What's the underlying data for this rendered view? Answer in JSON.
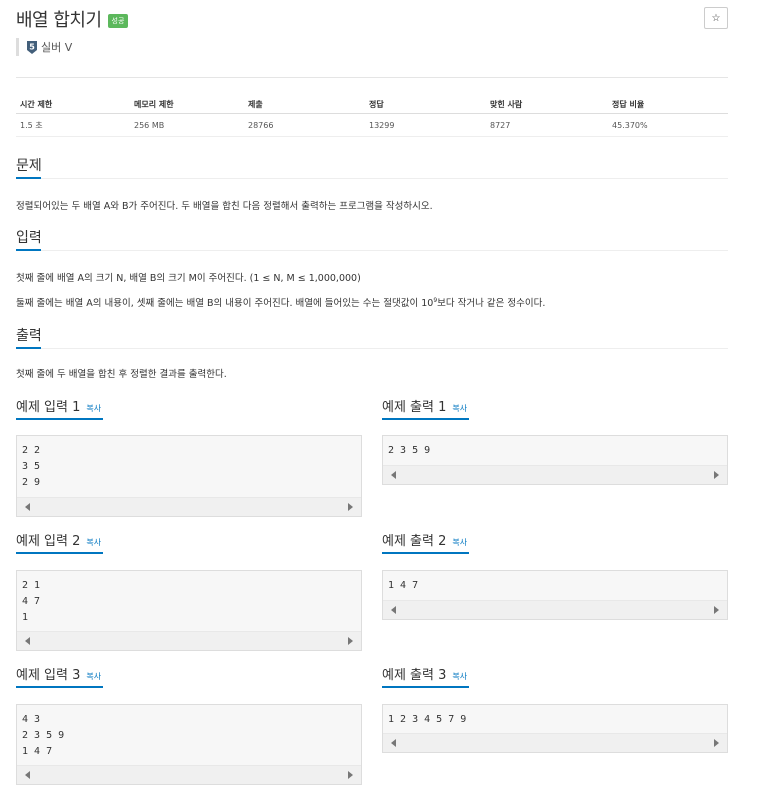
{
  "header": {
    "title": "배열 합치기",
    "status_badge": "성공",
    "star_label": "☆",
    "tier_label": "실버 V",
    "tier_number": "5"
  },
  "stats": {
    "headers": [
      "시간 제한",
      "메모리 제한",
      "제출",
      "정답",
      "맞힌 사람",
      "정답 비율"
    ],
    "values": [
      "1.5 초",
      "256 MB",
      "28766",
      "13299",
      "8727",
      "45.370%"
    ]
  },
  "problem": {
    "title": "문제",
    "text": "정렬되어있는 두 배열 A와 B가 주어진다. 두 배열을 합친 다음 정렬해서 출력하는 프로그램을 작성하시오."
  },
  "input": {
    "title": "입력",
    "line1": "첫째 줄에 배열 A의 크기 N, 배열 B의 크기 M이 주어진다. (1 ≤ N, M ≤ 1,000,000)",
    "line2_a": "둘째 줄에는 배열 A의 내용이, 셋째 줄에는 배열 B의 내용이 주어진다. 배열에 들어있는 수는 절댓값이 10",
    "line2_sup": "9",
    "line2_b": "보다 작거나 같은 정수이다."
  },
  "output": {
    "title": "출력",
    "text": "첫째 줄에 두 배열을 합친 후 정렬한 결과를 출력한다."
  },
  "copy_label": "복사",
  "samples": [
    {
      "in_title": "예제 입력 1",
      "in_text": "2 2\n3 5\n2 9",
      "out_title": "예제 출력 1",
      "out_text": "2 3 5 9"
    },
    {
      "in_title": "예제 입력 2",
      "in_text": "2 1\n4 7\n1",
      "out_title": "예제 출력 2",
      "out_text": "1 4 7"
    },
    {
      "in_title": "예제 입력 3",
      "in_text": "4 3\n2 3 5 9\n1 4 7",
      "out_title": "예제 출력 3",
      "out_text": "1 2 3 4 5 7 9"
    }
  ]
}
